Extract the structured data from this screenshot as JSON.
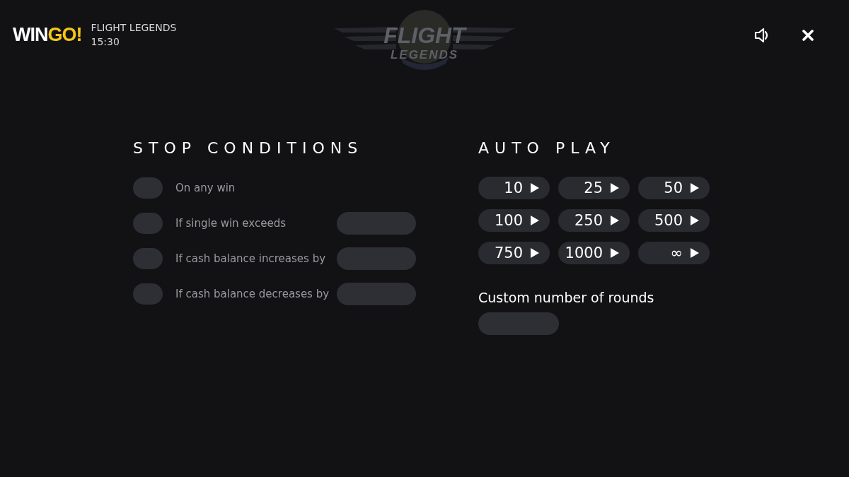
{
  "brand": {
    "main": "WIN",
    "accent": "GO!"
  },
  "game": {
    "title": "FLIGHT LEGENDS",
    "time": "15:30"
  },
  "logo": {
    "line1": "FLIGHT",
    "line2": "LEGENDS"
  },
  "stop_conditions": {
    "title": "STOP CONDITIONS",
    "items": [
      {
        "label": "On any win",
        "on": false,
        "kind": "toggle"
      },
      {
        "label": "If single win exceeds",
        "on": false,
        "kind": "toggle-field"
      },
      {
        "label": "If cash balance increases by",
        "on": false,
        "kind": "toggle-field"
      },
      {
        "label": "If cash balance decreases by",
        "on": false,
        "kind": "toggle-field"
      }
    ]
  },
  "auto_play": {
    "title": "AUTO PLAY",
    "options": [
      {
        "label": "10",
        "selected": false
      },
      {
        "label": "25",
        "selected": false
      },
      {
        "label": "50",
        "selected": false
      },
      {
        "label": "100",
        "selected": false
      },
      {
        "label": "250",
        "selected": false
      },
      {
        "label": "500",
        "selected": false
      },
      {
        "label": "750",
        "selected": false
      },
      {
        "label": "1000",
        "selected": false
      },
      {
        "label": "∞",
        "selected": false
      }
    ],
    "custom_label": "Custom number of rounds"
  }
}
